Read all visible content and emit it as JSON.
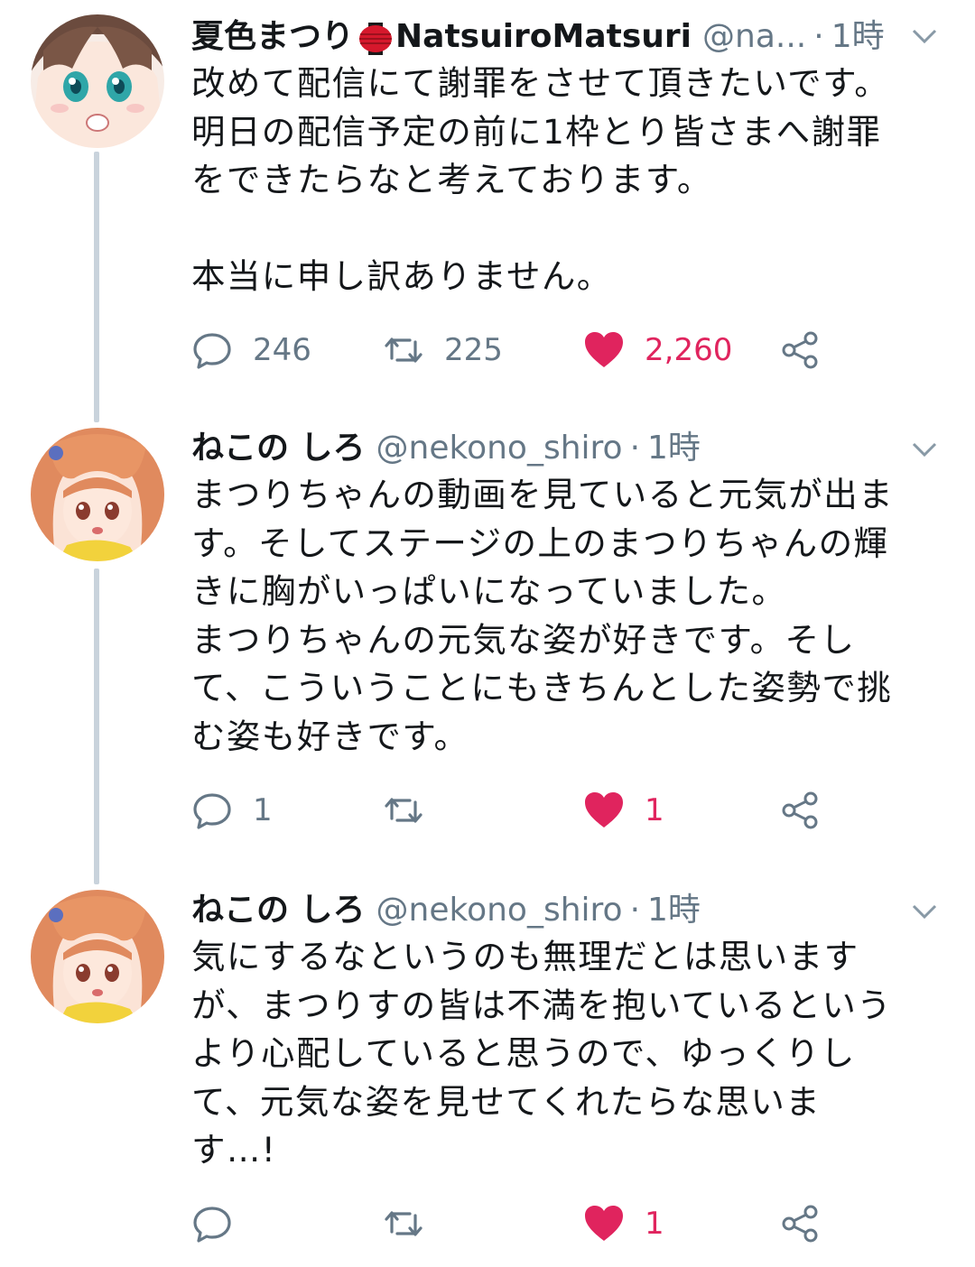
{
  "tweets": [
    {
      "name": "夏色まつり",
      "name_suffix": "NatsuiroMatsuri",
      "handle": "@na...",
      "time": "1時",
      "text": "改めて配信にて謝罪をさせて頂きたいです。\n明日の配信予定の前に1枠とり皆さまへ謝罪\nをできたらなと考えております。\n\n本当に申し訳ありません。",
      "replies": "246",
      "retweets": "225",
      "likes": "2,260",
      "liked": true
    },
    {
      "name": "ねこの しろ",
      "handle": "@nekono_shiro",
      "time": "1時",
      "text": "まつりちゃんの動画を見ていると元気が出ま\nす。そしてステージの上のまつりちゃんの輝\nきに胸がいっぱいになっていました。\nまつりちゃんの元気な姿が好きです。そし\nて、こういうことにもきちんとした姿勢で挑\nむ姿も好きです。",
      "replies": "1",
      "retweets": "",
      "likes": "1",
      "liked": true
    },
    {
      "name": "ねこの しろ",
      "handle": "@nekono_shiro",
      "time": "1時",
      "text": "気にするなというのも無理だとは思います\nが、まつりすの皆は不満を抱いているという\nより心配していると思うので、ゆっくりし\nて、元気な姿を見せてくれたらな思いま\nす…!",
      "replies": "",
      "retweets": "",
      "likes": "1",
      "liked": true
    }
  ],
  "separator": "·",
  "icons": {
    "reply": "reply-icon",
    "retweet": "retweet-icon",
    "like": "heart-icon",
    "share": "share-icon",
    "caret": "chevron-down-icon",
    "lantern": "lantern-emoji-icon"
  },
  "colors": {
    "text": "#14171a",
    "secondary": "#657786",
    "like": "#e0245e",
    "thread_line": "#c9d3dc"
  }
}
